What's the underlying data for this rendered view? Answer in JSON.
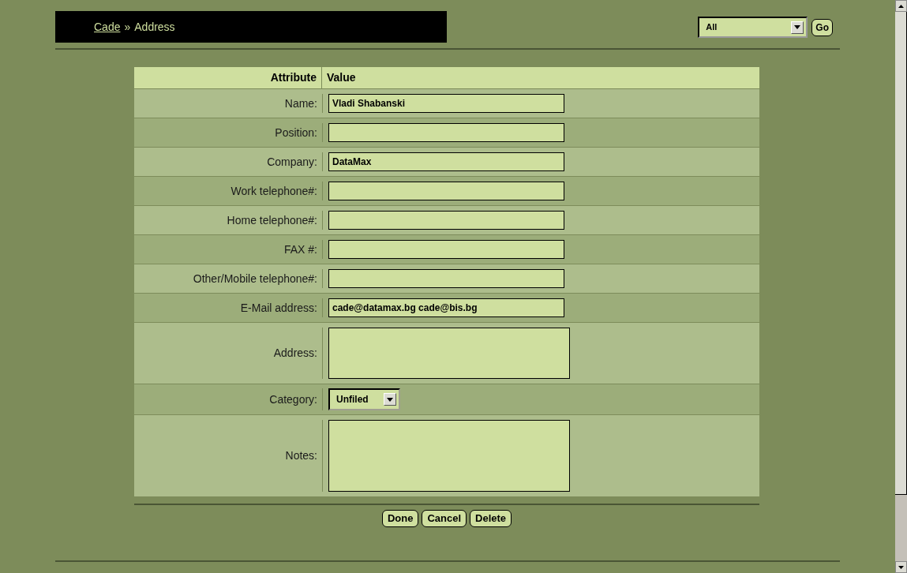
{
  "breadcrumb": {
    "link": "Cade",
    "separator": "»",
    "current": "Address"
  },
  "filter": {
    "value": "All",
    "button": "Go"
  },
  "table": {
    "columns": [
      "Attribute",
      "Value"
    ],
    "rows": [
      {
        "label": "Name:",
        "kind": "text",
        "value": "Vladi Shabanski"
      },
      {
        "label": "Position:",
        "kind": "text",
        "value": ""
      },
      {
        "label": "Company:",
        "kind": "text",
        "value": "DataMax"
      },
      {
        "label": "Work telephone#:",
        "kind": "text",
        "value": ""
      },
      {
        "label": "Home telephone#:",
        "kind": "text",
        "value": ""
      },
      {
        "label": "FAX #:",
        "kind": "text",
        "value": ""
      },
      {
        "label": "Other/Mobile telephone#:",
        "kind": "text",
        "value": ""
      },
      {
        "label": "E-Mail address:",
        "kind": "text",
        "value": "cade@datamax.bg cade@bis.bg"
      },
      {
        "label": "Address:",
        "kind": "textarea",
        "value": ""
      },
      {
        "label": "Category:",
        "kind": "select",
        "value": "Unfiled"
      },
      {
        "label": "Notes:",
        "kind": "memo",
        "value": ""
      }
    ]
  },
  "buttons": [
    "Done",
    "Cancel",
    "Delete"
  ]
}
